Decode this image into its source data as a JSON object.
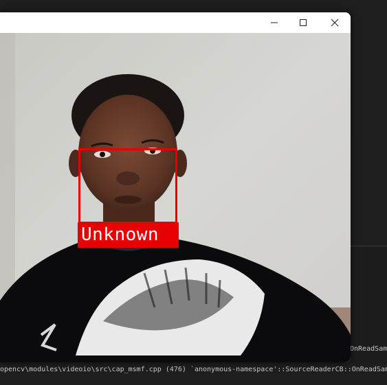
{
  "window": {
    "controls": {
      "minimize_icon": "minimize-icon",
      "maximize_icon": "maximize-icon",
      "close_icon": "close-icon"
    }
  },
  "detection": {
    "label": "Unknown",
    "box_color": "#e60000"
  },
  "terminal": {
    "right_fragment": "OnReadSam",
    "bottom_line": "opencv\\modules\\videoio\\src\\cap_msmf.cpp (476) `anonymous-namespace'::SourceReaderCB::OnReadSam"
  }
}
